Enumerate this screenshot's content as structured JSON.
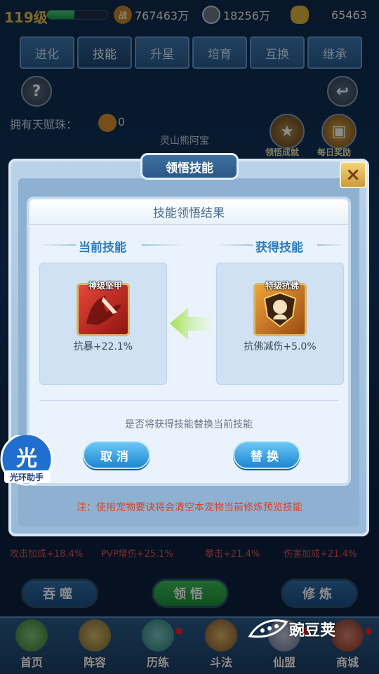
{
  "top": {
    "level": "119级",
    "level_progress": 0.45,
    "battle_icon": "战",
    "battle_power": "767463万",
    "silver": "18256万",
    "gold": "65463"
  },
  "tabs": [
    "进化",
    "技能",
    "升星",
    "培育",
    "互换",
    "继承"
  ],
  "background": {
    "talent_label": "拥有天赋珠：",
    "talent_count": "0",
    "pet_name": "灵山熊阿宝",
    "achievement_label": "领悟成就",
    "daily_label": "每日奖励",
    "stats": [
      "攻击加成+18.4%",
      "PVP增伤+25.1%",
      "暴击+21.4%",
      "伤害加成+21.4%"
    ],
    "actions": [
      "吞噬",
      "领悟",
      "修炼"
    ]
  },
  "outer_dialog": {
    "title": "领悟技能",
    "close_icon": "×",
    "note": "注：使用宠物要诀将会清空本宠物当前修炼预览技能"
  },
  "result_dialog": {
    "title": "技能领悟结果",
    "current_label": "当前技能",
    "gained_label": "获得技能",
    "current_skill": {
      "tag": "神级坚甲",
      "desc": "抗暴+22.1%"
    },
    "gained_skill": {
      "tag": "特级抗佛",
      "desc": "抗佛减伤+5.0%"
    },
    "question": "是否将获得技能替换当前技能",
    "cancel_label": "取消",
    "replace_label": "替换"
  },
  "watermarks": {
    "badge_char": "光",
    "badge_label": "光环助手",
    "brand": "豌豆荚"
  },
  "nav": [
    {
      "label": "首页"
    },
    {
      "label": "阵容"
    },
    {
      "label": "历练"
    },
    {
      "label": "斗法"
    },
    {
      "label": "仙盟"
    },
    {
      "label": "商城"
    }
  ],
  "colors": {
    "accent_blue": "#1c86d3",
    "title_blue": "#2b7cc0",
    "note_red": "#d9432a",
    "gold": "#e6c34d"
  }
}
